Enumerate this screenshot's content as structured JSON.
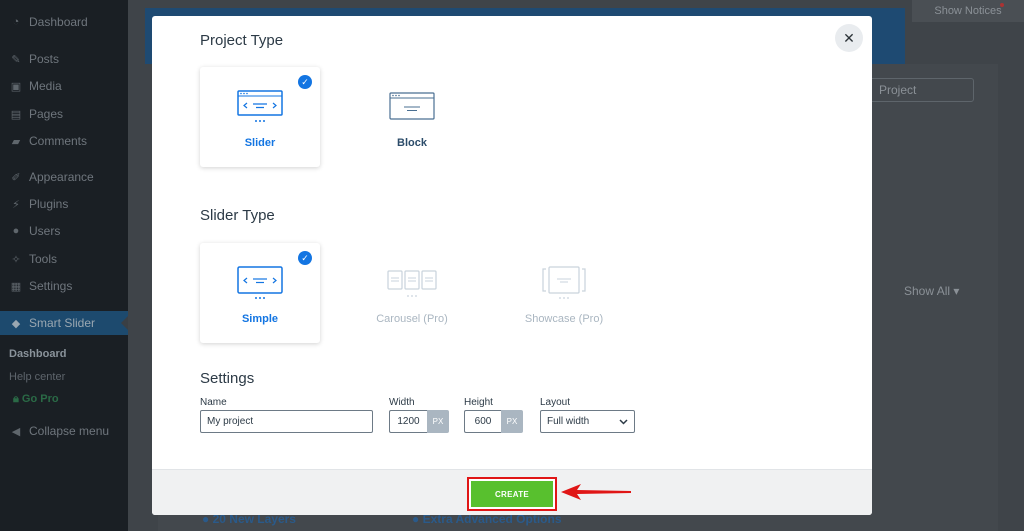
{
  "sidebar": {
    "items": [
      {
        "label": "Dashboard",
        "icon": "dashboard-icon"
      },
      {
        "label": "Posts",
        "icon": "pin-icon"
      },
      {
        "label": "Media",
        "icon": "media-icon"
      },
      {
        "label": "Pages",
        "icon": "pages-icon"
      },
      {
        "label": "Comments",
        "icon": "comment-icon"
      },
      {
        "label": "Appearance",
        "icon": "brush-icon"
      },
      {
        "label": "Plugins",
        "icon": "plugin-icon"
      },
      {
        "label": "Users",
        "icon": "user-icon"
      },
      {
        "label": "Tools",
        "icon": "wrench-icon"
      },
      {
        "label": "Settings",
        "icon": "settings-icon"
      },
      {
        "label": "Smart Slider",
        "icon": "mortarboard-icon"
      }
    ],
    "submenu": {
      "dashboard": "Dashboard",
      "help": "Help center",
      "go_pro": "Go Pro"
    },
    "collapse": "Collapse menu"
  },
  "background": {
    "show_notices": "Show Notices",
    "project_button": "Project",
    "show_all": "Show All ▾",
    "feature_1": "20 New Layers",
    "feature_2": "Extra Advanced Options"
  },
  "modal": {
    "project_type_title": "Project Type",
    "project_types": [
      {
        "label": "Slider",
        "selected": true
      },
      {
        "label": "Block",
        "selected": false
      }
    ],
    "slider_type_title": "Slider Type",
    "slider_types": [
      {
        "label": "Simple",
        "selected": true
      },
      {
        "label": "Carousel (Pro)",
        "selected": false
      },
      {
        "label": "Showcase (Pro)",
        "selected": false
      }
    ],
    "settings_title": "Settings",
    "settings": {
      "name_label": "Name",
      "name_value": "My project",
      "width_label": "Width",
      "width_value": "1200",
      "height_label": "Height",
      "height_value": "600",
      "unit": "PX",
      "layout_label": "Layout",
      "layout_value": "Full width"
    },
    "create_label": "CREATE",
    "close_symbol": "✕"
  },
  "colors": {
    "accent": "#1375e2",
    "create": "#58c02e",
    "highlight": "#e01616"
  }
}
